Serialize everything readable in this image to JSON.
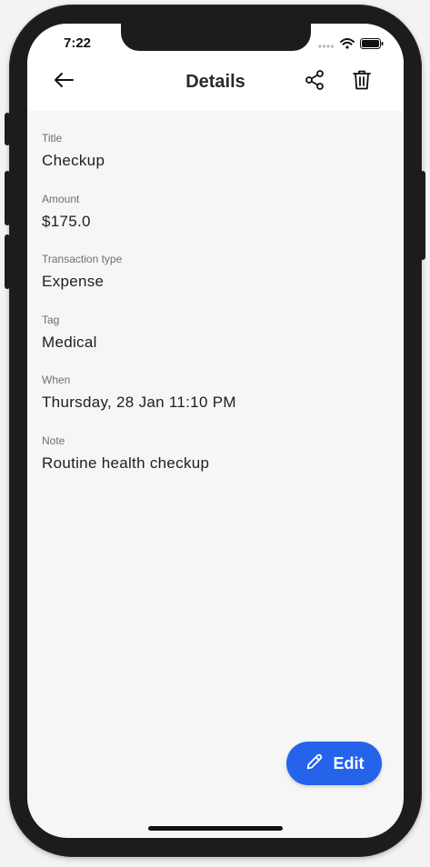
{
  "status_bar": {
    "time": "7:22",
    "icons": [
      "signal-icon",
      "wifi-icon",
      "battery-icon"
    ]
  },
  "app_bar": {
    "title": "Details",
    "back_icon": "arrow-left-icon",
    "share_icon": "share-icon",
    "delete_icon": "trash-icon"
  },
  "details": [
    {
      "label": "Title",
      "value": "Checkup"
    },
    {
      "label": "Amount",
      "value": "$175.0"
    },
    {
      "label": "Transaction type",
      "value": "Expense"
    },
    {
      "label": "Tag",
      "value": "Medical"
    },
    {
      "label": "When",
      "value": "Thursday, 28 Jan 11:10 PM"
    },
    {
      "label": "Note",
      "value": "Routine health checkup"
    }
  ],
  "fab": {
    "label": "Edit",
    "icon": "pencil-icon",
    "color": "#2563eb"
  }
}
